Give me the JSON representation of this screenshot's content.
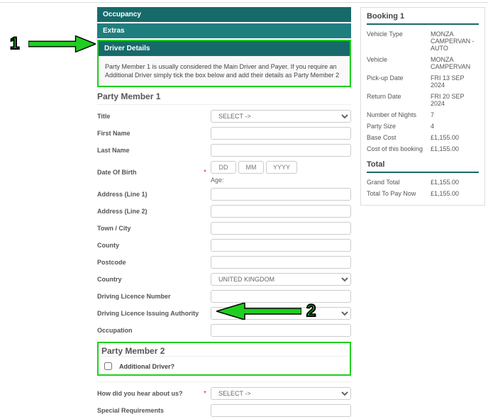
{
  "bars": {
    "occupancy": "Occupancy",
    "extras": "Extras",
    "driver_details": "Driver Details"
  },
  "notice": "Party Member 1 is usually considered the Main Driver and Payer. If you require an Additional Driver simply tick the box below and add their details as Party Member 2",
  "pm1": {
    "heading": "Party Member 1",
    "title_label": "Title",
    "title_select": "SELECT ->",
    "first_name": "First Name",
    "last_name": "Last Name",
    "dob_label": "Date Of Birth",
    "dob_dd": "DD",
    "dob_mm": "MM",
    "dob_yyyy": "YYYY",
    "age_label": "Age:",
    "addr1": "Address (Line 1)",
    "addr2": "Address (Line 2)",
    "town": "Town / City",
    "county": "County",
    "postcode": "Postcode",
    "country_label": "Country",
    "country_select": "UNITED KINGDOM",
    "licence_no": "Driving Licence Number",
    "licence_auth": "Driving Licence Issuing Authority",
    "occupation": "Occupation"
  },
  "pm2": {
    "heading": "Party Member 2",
    "checkbox_label": "Additional Driver?"
  },
  "extra_q": {
    "hear_label": "How did you hear about us?",
    "hear_select": "SELECT ->",
    "special_label": "Special Requirements"
  },
  "side": {
    "title": "Booking 1",
    "rows": [
      {
        "k": "Vehicle Type",
        "v": "MONZA CAMPERVAN - AUTO"
      },
      {
        "k": "Vehicle",
        "v": "MONZA CAMPERVAN"
      },
      {
        "k": "Pick-up Date",
        "v": "FRI 13 SEP 2024"
      },
      {
        "k": "Return Date",
        "v": "FRI 20 SEP 2024"
      },
      {
        "k": "Number of Nights",
        "v": "7"
      },
      {
        "k": "Party Size",
        "v": "4"
      },
      {
        "k": "Base Cost",
        "v": "£1,155.00"
      },
      {
        "k": "Cost of this booking",
        "v": "£1,155.00"
      }
    ],
    "total_title": "Total",
    "total_rows": [
      {
        "k": "Grand Total",
        "v": "£1,155.00"
      },
      {
        "k": "Total To Pay Now",
        "v": "£1,155.00"
      }
    ]
  },
  "annotations": {
    "one": "1",
    "two": "2"
  }
}
